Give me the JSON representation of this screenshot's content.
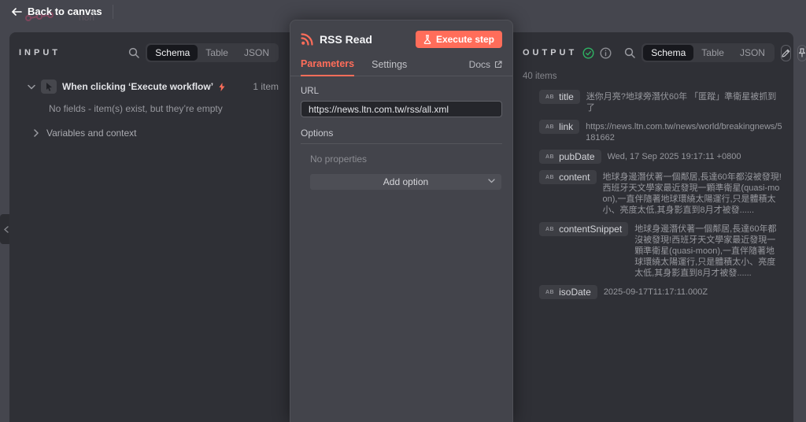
{
  "topbar": {
    "back_label": "Back to canvas",
    "new_tab_label": "+"
  },
  "input_panel": {
    "title": "INPUT",
    "tabs": {
      "schema": "Schema",
      "table": "Table",
      "json": "JSON"
    },
    "trigger": {
      "label": "When clicking ‘Execute workflow’",
      "count": "1 item"
    },
    "empty_message": "No fields - item(s) exist, but they’re empty",
    "variables_label": "Variables and context"
  },
  "node_panel": {
    "title": "RSS Read",
    "execute_label": "Execute step",
    "tabs": {
      "parameters": "Parameters",
      "settings": "Settings",
      "docs": "Docs"
    },
    "url": {
      "label": "URL",
      "value": "https://news.ltn.com.tw/rss/all.xml"
    },
    "options": {
      "label": "Options",
      "empty": "No properties",
      "add_label": "Add option"
    }
  },
  "output_panel": {
    "title": "OUTPUT",
    "items_count": "40 items",
    "tabs": {
      "schema": "Schema",
      "table": "Table",
      "json": "JSON"
    },
    "fields": [
      {
        "type": "AB",
        "name": "title",
        "value": "迷你月亮?地球旁潛伏60年 「匿蹤」準衛星被抓到了"
      },
      {
        "type": "AB",
        "name": "link",
        "value": "https://news.ltn.com.tw/news/world/breakingnews/5181662"
      },
      {
        "type": "AB",
        "name": "pubDate",
        "value": "Wed, 17 Sep 2025 19:17:11 +0800"
      },
      {
        "type": "AB",
        "name": "content",
        "value": "地球身邊潛伏著一個鄰居,長達60年都沒被發現!西班牙天文學家最近發現一顆準衛星(quasi-moon),一直伴隨著地球環繞太陽運行,只是體積太小、亮度太低,其身影直到8月才被發......"
      },
      {
        "type": "AB",
        "name": "contentSnippet",
        "value": "地球身邊潛伏著一個鄰居,長達60年都沒被發現!西班牙天文學家最近發現一顆準衛星(quasi-moon),一直伴隨著地球環繞太陽運行,只是體積太小、亮度太低,其身影直到8月才被發......"
      },
      {
        "type": "AB",
        "name": "isoDate",
        "value": "2025-09-17T11:17:11.000Z"
      }
    ]
  },
  "colors": {
    "accent": "#ff6d5a",
    "success": "#2fb463"
  }
}
